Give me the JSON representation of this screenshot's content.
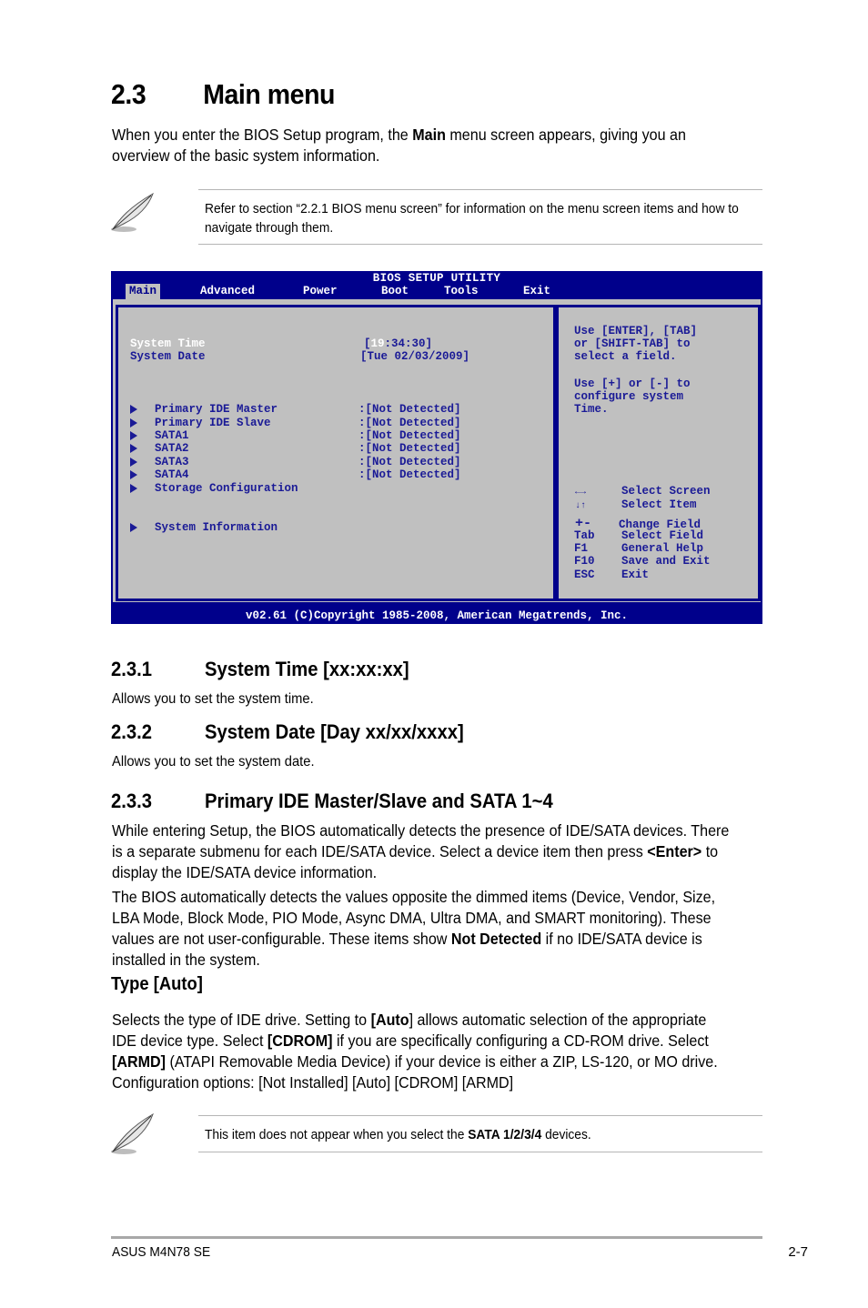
{
  "section": {
    "number": "2.3",
    "title": "Main menu",
    "intro_parts": [
      "When you enter the BIOS Setup program, the ",
      "Main",
      " menu screen appears, giving you an overview of the basic system information."
    ]
  },
  "note1": {
    "icon": "feather-pen-icon",
    "text": "Refer to section “2.2.1 BIOS menu screen” for information on the menu screen items and how to navigate through them."
  },
  "bios": {
    "title": "BIOS SETUP UTILITY",
    "tabs": [
      "Main",
      "Advanced",
      "Power",
      "Boot",
      "Tools",
      "Exit"
    ],
    "active_tab": "Main",
    "system_time": {
      "label": "System Time",
      "value_open": "[",
      "value_highlight": "19",
      "value_rest": ":34:30]"
    },
    "system_date": {
      "label": "System Date",
      "value": "[Tue 02/03/2009]"
    },
    "devices": [
      {
        "label": "Primary IDE Master",
        "value": ":[Not Detected]"
      },
      {
        "label": "Primary IDE Slave",
        "value": ":[Not Detected]"
      },
      {
        "label": "SATA1",
        "value": ":[Not Detected]"
      },
      {
        "label": "SATA2",
        "value": ":[Not Detected]"
      },
      {
        "label": "SATA3",
        "value": ":[Not Detected]"
      },
      {
        "label": "SATA4",
        "value": ":[Not Detected]"
      },
      {
        "label": "Storage Configuration",
        "value": ""
      }
    ],
    "system_information": "System Information",
    "help_lines": [
      "Use [ENTER], [TAB]",
      "or [SHIFT-TAB] to",
      "select a field.",
      "",
      "Use [+] or [-] to",
      "configure system",
      "Time."
    ],
    "keys": [
      {
        "key": "←→",
        "action": "Select Screen"
      },
      {
        "key": "↓↑",
        "action": "Select Item"
      },
      {
        "key": "+-",
        "action": "Change Field"
      },
      {
        "key": "Tab",
        "action": "Select Field"
      },
      {
        "key": "F1",
        "action": "General Help"
      },
      {
        "key": "F10",
        "action": "Save and Exit"
      },
      {
        "key": "ESC",
        "action": "Exit"
      }
    ],
    "footer": "v02.61 (C)Copyright 1985-2008, American Megatrends, Inc.",
    "colors": {
      "background": "#00008b",
      "panel": "#c0c0c0",
      "text": "#1a1a96",
      "highlight": "#ffffff"
    }
  },
  "sub1": {
    "number": "2.3.1",
    "title": "System Time [xx:xx:xx]",
    "text": "Allows you to set the system time."
  },
  "sub2": {
    "number": "2.3.2",
    "title": "System Date [Day xx/xx/xxxx]",
    "text": "Allows you to set the system date."
  },
  "sub3": {
    "number": "2.3.3",
    "title": "Primary IDE Master/Slave and SATA 1~4",
    "p1_parts": [
      "While entering Setup, the BIOS automatically detects the presence of IDE/SATA devices. There is a separate submenu for each IDE/SATA device. Select a device item then press ",
      "<Enter>",
      " to display the IDE/SATA device information."
    ],
    "p2_parts": [
      "The BIOS automatically detects the values opposite the dimmed items (Device, Vendor, Size, LBA Mode, Block Mode, PIO Mode, Async DMA, Ultra DMA, and SMART monitoring). These values are not user-configurable. These items show ",
      "Not Detected",
      " if no IDE/SATA device is installed in the system."
    ]
  },
  "type": {
    "heading": "Type [Auto]",
    "parts": [
      "Selects the type of IDE drive. Setting to ",
      "[Auto",
      "] allows automatic selection of the appropriate IDE device type. Select ",
      "[CDROM]",
      " if you are specifically configuring a CD-ROM drive. Select ",
      "[ARMD]",
      " (ATAPI Removable Media Device) if your device is either a ZIP, LS-120, or MO drive. Configuration options: [Not Installed] [Auto] [CDROM] [ARMD]"
    ]
  },
  "note2": {
    "icon": "feather-pen-icon",
    "parts": [
      "This item does not appear when you select the ",
      "SATA 1/2/3/4",
      " devices."
    ]
  },
  "footer": {
    "product": "ASUS M4N78 SE",
    "page": "2-7"
  }
}
